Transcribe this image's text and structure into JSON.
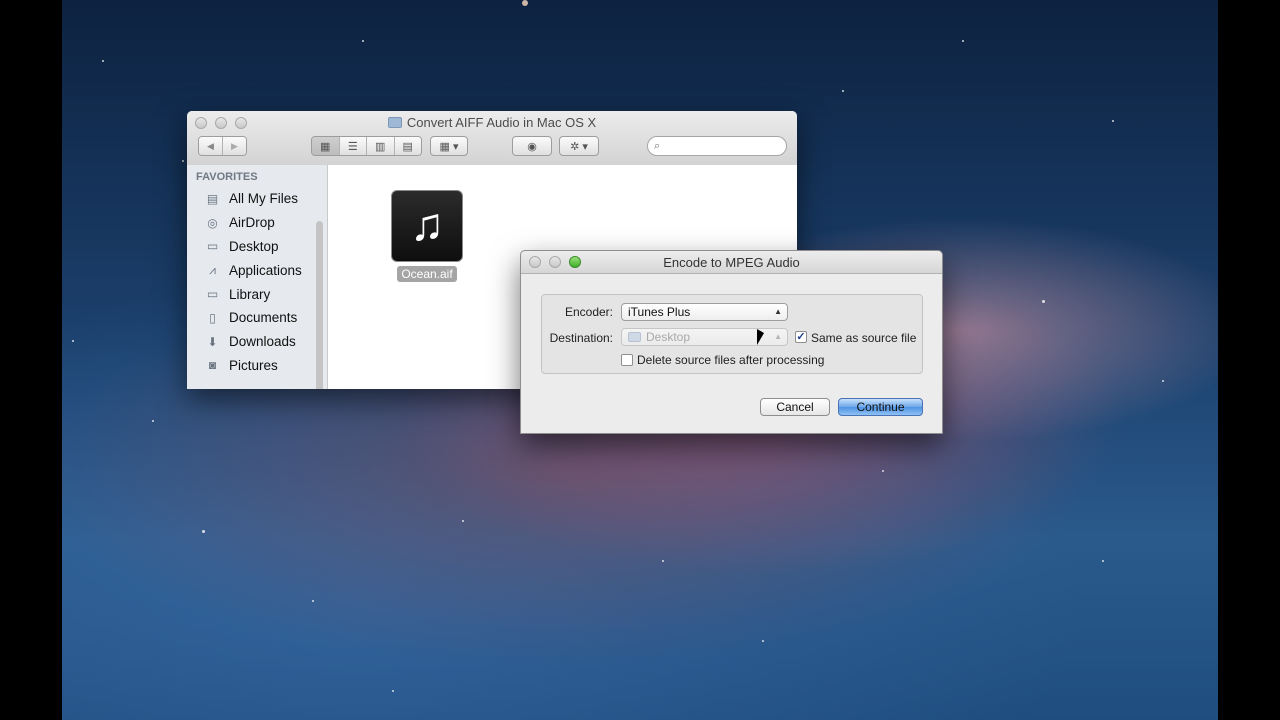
{
  "finder": {
    "title": "Convert AIFF Audio in Mac OS X",
    "nav": {
      "back": "◀",
      "forward": "▶"
    },
    "view_modes": [
      "icon-view",
      "list-view",
      "column-view",
      "coverflow-view"
    ],
    "arrange_label": "arrange",
    "quicklook_label": "quick-look",
    "action_label": "action",
    "search": {
      "placeholder": "",
      "value": ""
    },
    "sidebar": {
      "heading": "FAVORITES",
      "items": [
        {
          "label": "All My Files",
          "icon": "all-files-icon"
        },
        {
          "label": "AirDrop",
          "icon": "airdrop-icon"
        },
        {
          "label": "Desktop",
          "icon": "desktop-icon"
        },
        {
          "label": "Applications",
          "icon": "applications-icon"
        },
        {
          "label": "Library",
          "icon": "folder-icon"
        },
        {
          "label": "Documents",
          "icon": "documents-icon"
        },
        {
          "label": "Downloads",
          "icon": "downloads-icon"
        },
        {
          "label": "Pictures",
          "icon": "camera-icon"
        }
      ]
    },
    "files": [
      {
        "name": "Ocean.aif",
        "icon": "music-note-icon"
      }
    ]
  },
  "dialog": {
    "title": "Encode to MPEG Audio",
    "encoder": {
      "label": "Encoder:",
      "value": "iTunes Plus"
    },
    "destination": {
      "label": "Destination:",
      "value": "Desktop",
      "enabled": false
    },
    "same_as_source": {
      "label": "Same as source file",
      "checked": true
    },
    "delete_source": {
      "label": "Delete source files after processing",
      "checked": false
    },
    "cancel_label": "Cancel",
    "continue_label": "Continue"
  }
}
